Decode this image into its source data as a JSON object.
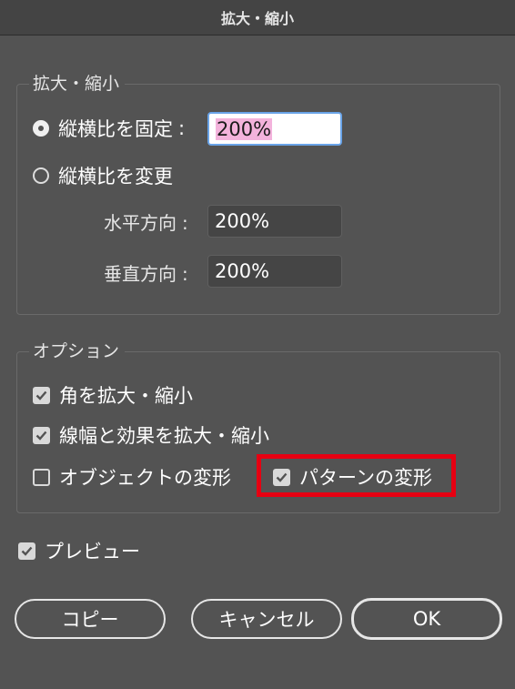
{
  "dialog": {
    "title": "拡大・縮小"
  },
  "scale_group": {
    "label": "拡大・縮小",
    "uniform": {
      "label": "縦横比を固定",
      "colon": ":",
      "value": "200%",
      "selected": true
    },
    "non_uniform": {
      "label": "縦横比を変更",
      "selected": false,
      "horizontal": {
        "label": "水平方向",
        "colon": ":",
        "value": "200%"
      },
      "vertical": {
        "label": "垂直方向",
        "colon": ":",
        "value": "200%"
      }
    }
  },
  "options_group": {
    "label": "オプション",
    "scale_corners": {
      "label": "角を拡大・縮小",
      "checked": true
    },
    "scale_strokes_effects": {
      "label": "線幅と効果を拡大・縮小",
      "checked": true
    },
    "transform_objects": {
      "label": "オブジェクトの変形",
      "checked": false
    },
    "transform_patterns": {
      "label": "パターンの変形",
      "checked": true
    }
  },
  "preview": {
    "label": "プレビュー",
    "checked": true
  },
  "buttons": {
    "copy": "コピー",
    "cancel": "キャンセル",
    "ok": "OK"
  },
  "colors": {
    "background": "#535353",
    "highlight": "#e60012",
    "active_field_border": "#6aa4e8",
    "text_selection": "#f3b3dc"
  }
}
